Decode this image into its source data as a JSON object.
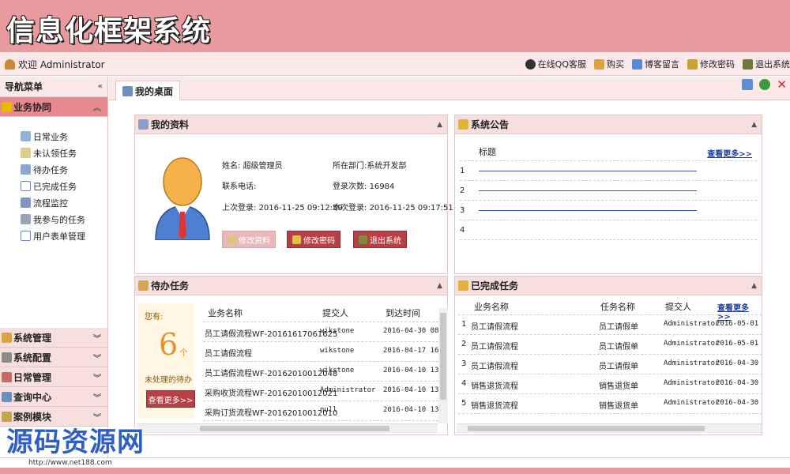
{
  "banner": {
    "title": "信息化框架系统"
  },
  "topbar": {
    "welcome": "欢迎 Administrator",
    "links": [
      "在线QQ客服",
      "购买",
      "博客留言",
      "修改密码",
      "退出系统"
    ]
  },
  "sidebar": {
    "title": "导航菜单",
    "active_category": "业务协同",
    "items": [
      "日常业务",
      "未认领任务",
      "待办任务",
      "已完成任务",
      "流程监控",
      "我参与的任务",
      "用户表单管理"
    ],
    "categories": [
      "系统管理",
      "系统配置",
      "日常管理",
      "查询中心",
      "案例模块"
    ]
  },
  "tab": {
    "label": "我的桌面"
  },
  "profile": {
    "title": "我的资料",
    "name_label": "姓名:",
    "name": "超级管理员",
    "dept_label": "所在部门:",
    "dept": "系统开发部",
    "phone_label": "联系电话:",
    "phone": "",
    "logins_label": "登录次数:",
    "logins": "16984",
    "last_label": "上次登录:",
    "last": "2016-11-25 09:12:59",
    "this_label": "本次登录:",
    "this": "2016-11-25 09:17:51",
    "buttons": [
      "修改资料",
      "修改密码",
      "退出系统"
    ]
  },
  "announcement": {
    "title": "系统公告",
    "col": "标题",
    "more": "查看更多>>",
    "rows": [
      "1",
      "2",
      "3",
      "4"
    ]
  },
  "pending": {
    "title": "待办任务",
    "you_have": "您有:",
    "count": "6",
    "unit": "个",
    "desc": "未处理的待办",
    "more": "查看更多>>",
    "headers": [
      "业务名称",
      "提交人",
      "到达时间"
    ],
    "rows": [
      [
        "员工请假流程WF-20161617061625",
        "wikstone",
        "2016-04-30 08:"
      ],
      [
        "员工请假流程",
        "wikstone",
        "2016-04-17 16:"
      ],
      [
        "员工请假流程WF-20162010012048",
        "wikstone",
        "2016-04-10 13:"
      ],
      [
        "采购收货流程WF-20162010012021",
        "Administrator",
        "2016-04-10 13:"
      ],
      [
        "采购订货流程WF-20162010012010",
        "null",
        "2016-04-10 13:"
      ]
    ]
  },
  "completed": {
    "title": "已完成任务",
    "more": "查看更多>>",
    "headers": [
      "业务名称",
      "任务名称",
      "提交人"
    ],
    "rows": [
      [
        "1",
        "员工请假流程",
        "员工请假单",
        "Administrator",
        "2016-05-01 11"
      ],
      [
        "2",
        "员工请假流程",
        "员工请假单",
        "Administrator",
        "2016-05-01 11"
      ],
      [
        "3",
        "员工请假流程",
        "员工请假单",
        "Administrator",
        "2016-04-30 08"
      ],
      [
        "4",
        "销售退货流程",
        "销售退货单",
        "Administrator",
        "2016-04-30 08"
      ],
      [
        "5",
        "销售退货流程",
        "销售退货单",
        "Administrator",
        "2016-04-30 08"
      ]
    ]
  },
  "watermark": {
    "text": "源码资源网",
    "url": "http://www.net188.com"
  }
}
